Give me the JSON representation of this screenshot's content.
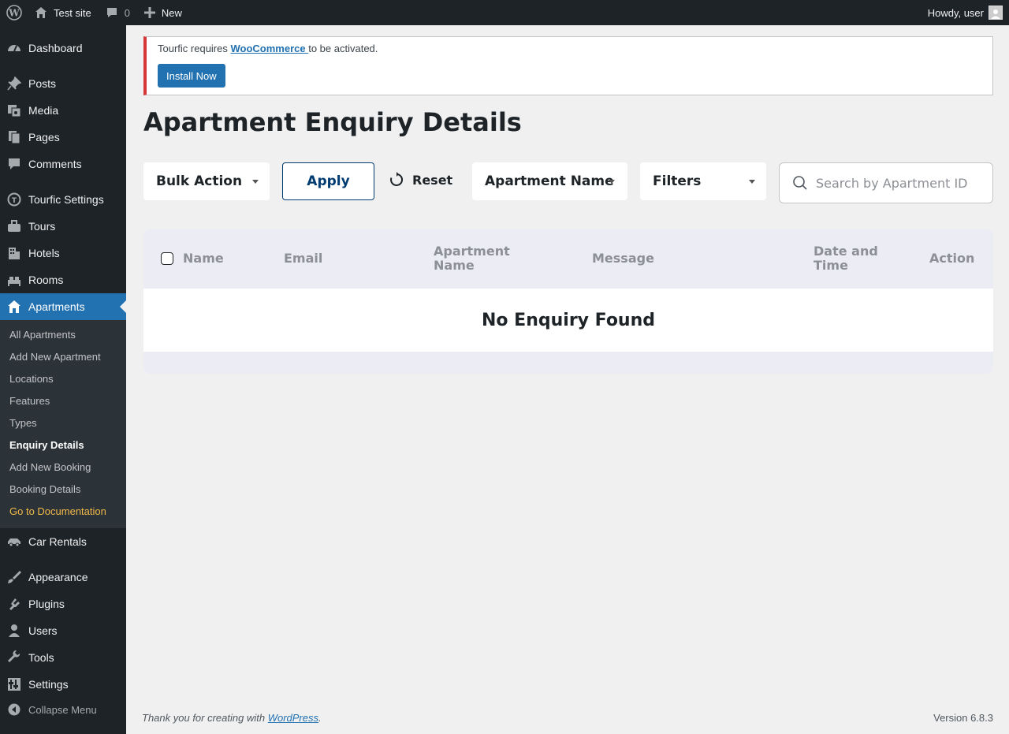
{
  "admin_bar": {
    "site_name": "Test site",
    "comment_count": "0",
    "new_label": "New",
    "howdy": "Howdy, user"
  },
  "sidebar": {
    "items": [
      {
        "label": "Dashboard",
        "icon": "dashboard-icon"
      },
      {
        "label": "Posts",
        "icon": "pin-icon"
      },
      {
        "label": "Media",
        "icon": "media-icon"
      },
      {
        "label": "Pages",
        "icon": "pages-icon"
      },
      {
        "label": "Comments",
        "icon": "comment-icon"
      },
      {
        "label": "Tourfic Settings",
        "icon": "tourfic-icon"
      },
      {
        "label": "Tours",
        "icon": "luggage-icon"
      },
      {
        "label": "Hotels",
        "icon": "building-icon"
      },
      {
        "label": "Rooms",
        "icon": "bed-icon"
      },
      {
        "label": "Apartments",
        "icon": "home-icon"
      },
      {
        "label": "Car Rentals",
        "icon": "car-icon"
      },
      {
        "label": "Appearance",
        "icon": "brush-icon"
      },
      {
        "label": "Plugins",
        "icon": "plugin-icon"
      },
      {
        "label": "Users",
        "icon": "users-icon"
      },
      {
        "label": "Tools",
        "icon": "wrench-icon"
      },
      {
        "label": "Settings",
        "icon": "settings-icon"
      }
    ],
    "submenu": [
      "All Apartments",
      "Add New Apartment",
      "Locations",
      "Features",
      "Types",
      "Enquiry Details",
      "Add New Booking",
      "Booking Details",
      "Go to Documentation"
    ],
    "collapse_label": "Collapse Menu"
  },
  "notice": {
    "prefix": "Tourfic requires ",
    "link": "WooCommerce ",
    "suffix": "to be activated.",
    "button": "Install Now"
  },
  "page_title": "Apartment Enquiry Details",
  "controls": {
    "bulk_action": "Bulk Action",
    "apply": "Apply",
    "reset": "Reset",
    "apartment_name": "Apartment Name",
    "filters": "Filters",
    "search_placeholder": "Search by Apartment ID"
  },
  "table": {
    "columns": [
      "Name",
      "Email",
      "Apartment\nName",
      "Message",
      "Date and\nTime",
      "Action"
    ],
    "empty_message": "No Enquiry Found"
  },
  "footer": {
    "thanks_prefix": "Thank you for creating with ",
    "thanks_link": "WordPress",
    "thanks_suffix": ".",
    "version": "Version 6.8.3"
  }
}
